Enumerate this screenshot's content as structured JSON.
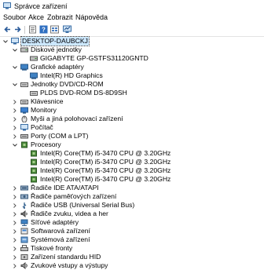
{
  "window": {
    "title": "Správce zařízení"
  },
  "menu": [
    "Soubor",
    "Akce",
    "Zobrazit",
    "Nápověda"
  ],
  "toolbar": [
    {
      "name": "back-icon"
    },
    {
      "name": "forward-icon"
    },
    {
      "name": "properties-icon"
    },
    {
      "name": "help-icon"
    },
    {
      "name": "view-icon"
    },
    {
      "name": "scan-icon"
    }
  ],
  "tree": [
    {
      "label": "DESKTOP-DAUBCKJ",
      "level": 0,
      "expanded": true,
      "icon": "computer-icon",
      "selected": true
    },
    {
      "label": "Diskové jednotky",
      "level": 1,
      "expanded": true,
      "icon": "disk-icon"
    },
    {
      "label": "GIGABYTE GP-GSTFS31120GNTD",
      "level": 2,
      "icon": "disk-icon"
    },
    {
      "label": "Grafické adaptéry",
      "level": 1,
      "expanded": true,
      "icon": "display-icon"
    },
    {
      "label": "Intel(R) HD Graphics",
      "level": 2,
      "icon": "display-icon"
    },
    {
      "label": "Jednotky DVD/CD-ROM",
      "level": 1,
      "expanded": true,
      "icon": "dvd-icon"
    },
    {
      "label": "PLDS DVD-ROM DS-8D9SH",
      "level": 2,
      "icon": "dvd-icon"
    },
    {
      "label": "Klávesnice",
      "level": 1,
      "expanded": false,
      "icon": "keyboard-icon"
    },
    {
      "label": "Monitory",
      "level": 1,
      "expanded": false,
      "icon": "monitor-icon"
    },
    {
      "label": "Myši a jiná polohovací zařízení",
      "level": 1,
      "expanded": false,
      "icon": "mouse-icon"
    },
    {
      "label": "Počítač",
      "level": 1,
      "expanded": false,
      "icon": "computer-icon"
    },
    {
      "label": "Porty (COM a LPT)",
      "level": 1,
      "expanded": false,
      "icon": "port-icon"
    },
    {
      "label": "Procesory",
      "level": 1,
      "expanded": true,
      "icon": "cpu-icon"
    },
    {
      "label": "Intel(R) Core(TM) i5-3470 CPU @ 3.20GHz",
      "level": 2,
      "icon": "cpu-icon"
    },
    {
      "label": "Intel(R) Core(TM) i5-3470 CPU @ 3.20GHz",
      "level": 2,
      "icon": "cpu-icon"
    },
    {
      "label": "Intel(R) Core(TM) i5-3470 CPU @ 3.20GHz",
      "level": 2,
      "icon": "cpu-icon"
    },
    {
      "label": "Intel(R) Core(TM) i5-3470 CPU @ 3.20GHz",
      "level": 2,
      "icon": "cpu-icon"
    },
    {
      "label": "Řadiče IDE ATA/ATAPI",
      "level": 1,
      "expanded": false,
      "icon": "ide-controller-icon"
    },
    {
      "label": "Řadiče paměťových zařízení",
      "level": 1,
      "expanded": false,
      "icon": "storage-controller-icon"
    },
    {
      "label": "Řadiče USB (Universal Serial Bus)",
      "level": 1,
      "expanded": false,
      "icon": "usb-icon"
    },
    {
      "label": "Řadiče zvuku, videa a her",
      "level": 1,
      "expanded": false,
      "icon": "sound-icon"
    },
    {
      "label": "Síťové adaptéry",
      "level": 1,
      "expanded": false,
      "icon": "network-icon"
    },
    {
      "label": "Softwarová zařízení",
      "level": 1,
      "expanded": false,
      "icon": "software-device-icon"
    },
    {
      "label": "Systémová zařízení",
      "level": 1,
      "expanded": false,
      "icon": "system-device-icon"
    },
    {
      "label": "Tiskové fronty",
      "level": 1,
      "expanded": false,
      "icon": "printer-icon"
    },
    {
      "label": "Zařízení standardu HID",
      "level": 1,
      "expanded": false,
      "icon": "hid-icon"
    },
    {
      "label": "Zvukové vstupy a výstupy",
      "level": 1,
      "expanded": false,
      "icon": "speaker-icon"
    }
  ]
}
